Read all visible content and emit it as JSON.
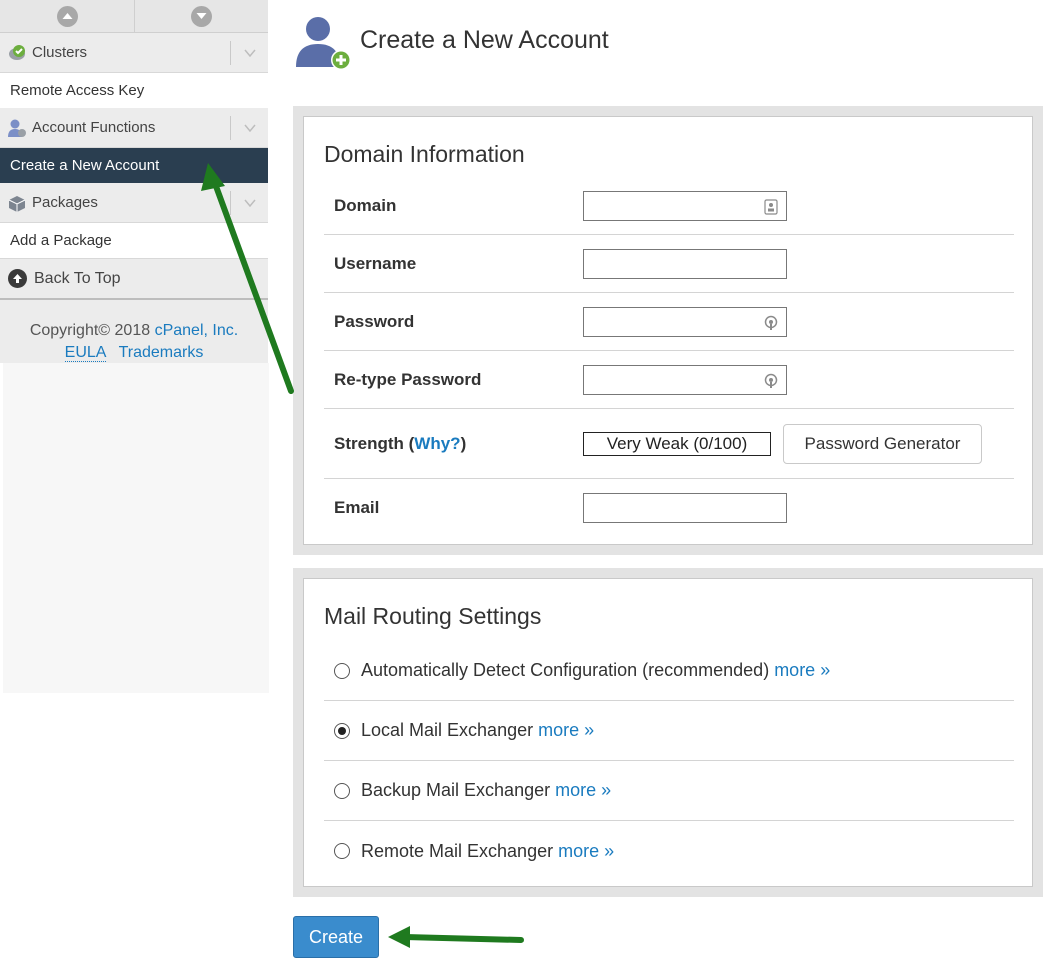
{
  "sidebar": {
    "categories": [
      {
        "label": "Clusters",
        "icon": "clusters-icon"
      },
      {
        "label": "Account Functions",
        "icon": "account-functions-icon"
      },
      {
        "label": "Packages",
        "icon": "packages-icon"
      }
    ],
    "items": {
      "remote_access_key": "Remote Access Key",
      "create_new_account": "Create a New Account",
      "add_package": "Add a Package"
    },
    "back_to_top": "Back To Top",
    "footer": {
      "copyright": "Copyright© 2018",
      "company": "cPanel, Inc.",
      "eula": "EULA",
      "trademarks": "Trademarks"
    },
    "active_color": "#2a3e50"
  },
  "page": {
    "title": "Create a New Account"
  },
  "domain_info": {
    "title": "Domain Information",
    "domain_label": "Domain",
    "domain_value": "",
    "username_label": "Username",
    "username_value": "",
    "password_label": "Password",
    "password_value": "",
    "retype_label": "Re-type Password",
    "retype_value": "",
    "strength_label": "Strength (",
    "strength_why": "Why?",
    "strength_close": ")",
    "strength_value": "Very Weak (0/100)",
    "generator_label": "Password Generator",
    "email_label": "Email",
    "email_value": ""
  },
  "mail_routing": {
    "title": "Mail Routing Settings",
    "more_label": "more »",
    "selected": "local",
    "options": [
      {
        "id": "auto",
        "label": "Automatically Detect Configuration (recommended)"
      },
      {
        "id": "local",
        "label": "Local Mail Exchanger"
      },
      {
        "id": "backup",
        "label": "Backup Mail Exchanger"
      },
      {
        "id": "remote",
        "label": "Remote Mail Exchanger"
      }
    ]
  },
  "actions": {
    "create_label": "Create"
  },
  "colors": {
    "link": "#1a7bbf",
    "primary_button": "#3a8ccd",
    "annotation_arrow": "#1f7a1f"
  }
}
